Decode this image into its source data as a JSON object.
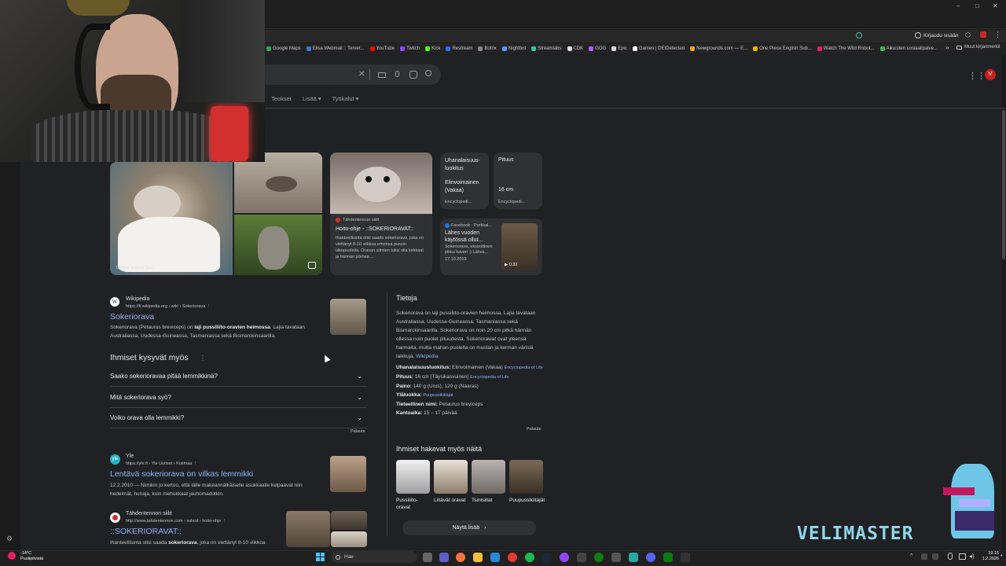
{
  "window": {
    "minimize": "–",
    "maximize": "□",
    "close": "✕"
  },
  "toolbar": {
    "signin_label": "Kirjaudu sisään"
  },
  "bookmarks": [
    {
      "label": "Google Maps",
      "color": "#34a853"
    },
    {
      "label": "Elisa Webmail :: Tervet...",
      "color": "#3c78d8"
    },
    {
      "label": "YouTube",
      "color": "#ff0000"
    },
    {
      "label": "Twitch",
      "color": "#9146ff"
    },
    {
      "label": "Kick",
      "color": "#53fc18"
    },
    {
      "label": "Restream",
      "color": "#2f6fed"
    },
    {
      "label": "Botrix",
      "color": "#888888"
    },
    {
      "label": "Nightbot",
      "color": "#4ea1ff"
    },
    {
      "label": "Streamlabs",
      "color": "#31c3a2"
    },
    {
      "label": "CDK",
      "color": "#dddddd"
    },
    {
      "label": "GOG",
      "color": "#b35cff"
    },
    {
      "label": "Epic",
      "color": "#dddddd"
    },
    {
      "label": "Games | DEIDetected",
      "color": "#ffffff"
    },
    {
      "label": "Newgrounds.com — E...",
      "color": "#f5a623"
    },
    {
      "label": "One Piece English Sub...",
      "color": "#e6b800"
    },
    {
      "label": "Watch The Wild Robot...",
      "color": "#e91e63"
    },
    {
      "label": "Aikuisten sosiaalipalve...",
      "color": "#4caf50"
    }
  ],
  "bookmarks_more": "»",
  "bookmarks_other": "Muut kirjanmerkit",
  "search": {
    "tabs": [
      "Teokset",
      "Lisää ▾",
      "Työkalut ▾"
    ]
  },
  "images": {
    "caption": "Lander Ireland Zoo"
  },
  "cards": {
    "source_card": {
      "site": "Tähdentennon siilit",
      "title": "Hoito-ohje - ::SOKERIORAVAT::",
      "snippet": "Ihanteellisinta olisi saada sokeriorava, joka on viettänyt 8-10 viikkoa emonsa pussin ulkopuolella. Oravan silmien tulisi olla kirkkaat ja hännän pörheä ..."
    },
    "status": {
      "title": "Uhanalaisuus-luokitus",
      "value": "Elinvoimainen (Vakaa)",
      "source": "Encyclopedi..."
    },
    "length": {
      "title": "Pituus",
      "value": "16 cm",
      "source": "Encyclopedi..."
    },
    "facebook": {
      "site": "Facebook · Porkkal...",
      "title": "Lähes vuoden käytössä ollut...",
      "snippet": "Sokeriorava, eksoottinen pikku kaveri :) Lähes...",
      "date": "17.10.2019",
      "duration": "0:32"
    }
  },
  "results": [
    {
      "site": "Wikipedia",
      "url": "https://fi.wikipedia.org › wiki › Sokeriorava",
      "title": "Sokeriorava",
      "snippet_pre": "Sokeriorava (Petaurus breviceps) on ",
      "snippet_bold": "laji pussiliito-oravien heimossa",
      "snippet_post": ". Lajia tavataan Australiassa, Uudessa-Guineassa, Tasmaniassa sekä Bismarckinsaarilla."
    },
    {
      "site": "Yle",
      "url": "https://yle.fi › Yle Uutiset › Kotimaa",
      "title": "Lentävä sokeriorava on vilkas lemmikki",
      "snippet": "12.2.2010 — Nimikin jo kertoo, että tälle makeannälkäiselle asukkaalle kelpaavat niin hedelmät, hunaja, kuin mehukkaat jauhomadotkin."
    },
    {
      "site": "Tähdentennon siilit",
      "url": "http://www.tahdentennon.com › sokrut › hoito-ohje",
      "title": "::SOKERIORAVAT::",
      "snippet_pre": "Ihanteellisinta olisi saada ",
      "snippet_bold": "sokeriorava",
      "snippet_post": ", joka on viettänyt 8-10 viikkoa"
    }
  ],
  "paa": {
    "title": "Ihmiset kysyvät myös",
    "questions": [
      "Saako sokerioravaa pitää lemmikkinä?",
      "Mitä sokeriorava syö?",
      "Voiko orava olla lemmikki?"
    ],
    "feedback": "Palaute"
  },
  "knowledge_panel": {
    "title": "Tietoja",
    "description": "Sokeriorava on laji pussiliito-oravien heimossa. Lajia tavataan Australiassa, Uudessa-Guineassa, Tasmaniassa sekä Bismarckinsaarilla. Sokeriorava on noin 20 cm pitkä hännän ollessa noin puolet pituudesta. Sokeriorawat ovat yleensä harmaita, mutta mahan puolelta on mustan ja kerman värisiä laikkuja.",
    "wiki_link": "Wikipedia",
    "facts": [
      {
        "label": "Uhanalaisuusluokitus:",
        "value": "Elinvoimainen (Vakaa)",
        "source": "Encyclopedia of Life"
      },
      {
        "label": "Pituus:",
        "value": "16 cm (Täysikasvuinen)",
        "source": "Encyclopedia of Life"
      },
      {
        "label": "Paino:",
        "value": "140 g (Uros), 120 g (Naaras)",
        "source": ""
      },
      {
        "label": "Yläluokka:",
        "value": "",
        "source": "Puupussikiitäjät"
      },
      {
        "label": "Tieteellinen nimi:",
        "value": "Petaurus breviceps",
        "source": ""
      },
      {
        "label": "Kantoaika:",
        "value": "15 – 17 päivää",
        "source": ""
      }
    ],
    "feedback": "Palaute",
    "also_search_title": "Ihmiset hakevat myös näitä",
    "also_search": [
      {
        "label": "Pussiliito-oravat"
      },
      {
        "label": "Liitävät oravat"
      },
      {
        "label": "Tsintsillat"
      },
      {
        "label": "Puupussikiitäjät"
      }
    ],
    "show_more": "Näytä lisää"
  },
  "taskbar": {
    "weather_temp": "-14°C",
    "weather_desc": "Puolipilvistä",
    "search_placeholder": "Hae",
    "time": "19.15",
    "date": "1.2.2026"
  },
  "overlay": {
    "brand": "VELIMASTER"
  }
}
